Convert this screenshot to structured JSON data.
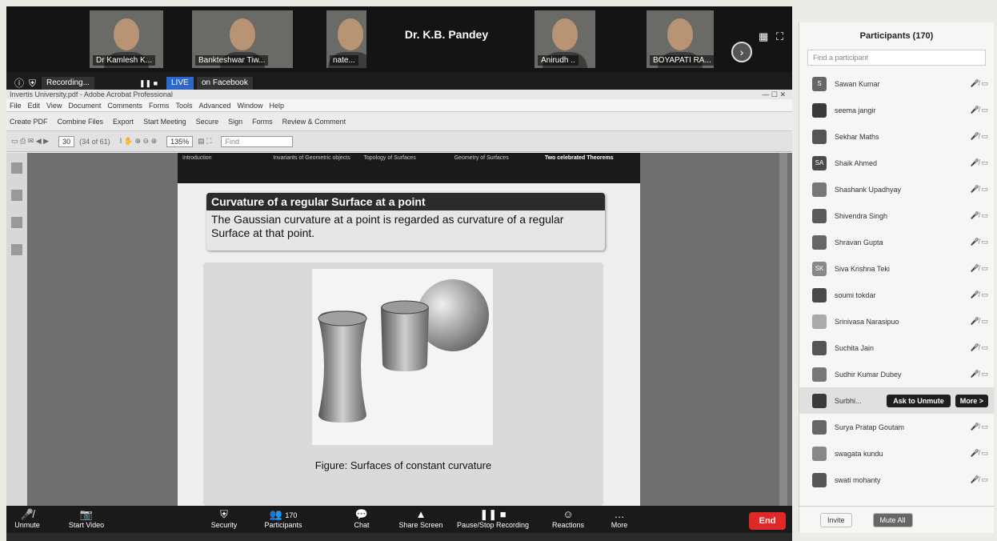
{
  "videos": [
    {
      "name": "Dr Kamlesh K...",
      "kind": "person"
    },
    {
      "name": "Bankteshwar Tiw...",
      "kind": "person"
    },
    {
      "name": "nate...",
      "kind": "person"
    },
    {
      "name": "",
      "center": "Dr. K.B. Pandey",
      "kind": "blank"
    },
    {
      "name": "Anirudh ..",
      "kind": "person"
    },
    {
      "name": "BOYAPATI RA...",
      "kind": "person"
    }
  ],
  "recording": {
    "status": "Recording...",
    "live": "LIVE",
    "platform": "on Facebook"
  },
  "acrobat": {
    "title": "Invertis University.pdf - Adobe Acrobat Professional",
    "menu": [
      "File",
      "Edit",
      "View",
      "Document",
      "Comments",
      "Forms",
      "Tools",
      "Advanced",
      "Window",
      "Help"
    ],
    "toolbar": [
      "Create PDF",
      "Combine Files",
      "Export",
      "Start Meeting",
      "Secure",
      "Sign",
      "Forms",
      "Review & Comment"
    ],
    "page": "30",
    "pages": "(34 of 61)",
    "zoom": "135%",
    "find": "Find"
  },
  "slide": {
    "nav": [
      "Introduction",
      "Invariants of Geometric objects",
      "Topology of Surfaces",
      "Geometry of Surfaces",
      "Two celebrated Theorems"
    ],
    "theorem_title": "Curvature of a regular Surface at a point",
    "theorem_text": "The Gaussian curvature at a point is regarded as curvature of a regular Surface at that point.",
    "caption": "Figure: Surfaces of constant curvature"
  },
  "bottombar": {
    "unmute": "Unmute",
    "video": "Start Video",
    "security": "Security",
    "participants": "Participants",
    "count": "170",
    "chat": "Chat",
    "share": "Share Screen",
    "pause": "Pause/Stop Recording",
    "reactions": "Reactions",
    "more": "More",
    "end": "End"
  },
  "panel": {
    "title": "Participants (170)",
    "search": "Find a participant",
    "participants": [
      {
        "name": "Sawan Kumar",
        "initials": "S"
      },
      {
        "name": "seema jangir",
        "initials": ""
      },
      {
        "name": "Sekhar Maths",
        "initials": ""
      },
      {
        "name": "Shaik Ahmed",
        "initials": "SA"
      },
      {
        "name": "Shashank Upadhyay",
        "initials": ""
      },
      {
        "name": "Shivendra Singh",
        "initials": ""
      },
      {
        "name": "Shravan Gupta",
        "initials": ""
      },
      {
        "name": "Siva Krishna Teki",
        "initials": "SK"
      },
      {
        "name": "soumi tokdar",
        "initials": ""
      },
      {
        "name": "Srinivasa Narasipuo",
        "initials": ""
      },
      {
        "name": "Suchita Jain",
        "initials": ""
      },
      {
        "name": "Sudhir Kumar Dubey",
        "initials": ""
      },
      {
        "name": "Surbhi...",
        "initials": ""
      },
      {
        "name": "Surya Pratap Goutam",
        "initials": ""
      },
      {
        "name": "swagata kundu",
        "initials": ""
      },
      {
        "name": "swati mohanty",
        "initials": ""
      }
    ],
    "ask": "Ask to Unmute",
    "more": "More >",
    "invite": "Invite",
    "muteall": "Mute All"
  }
}
